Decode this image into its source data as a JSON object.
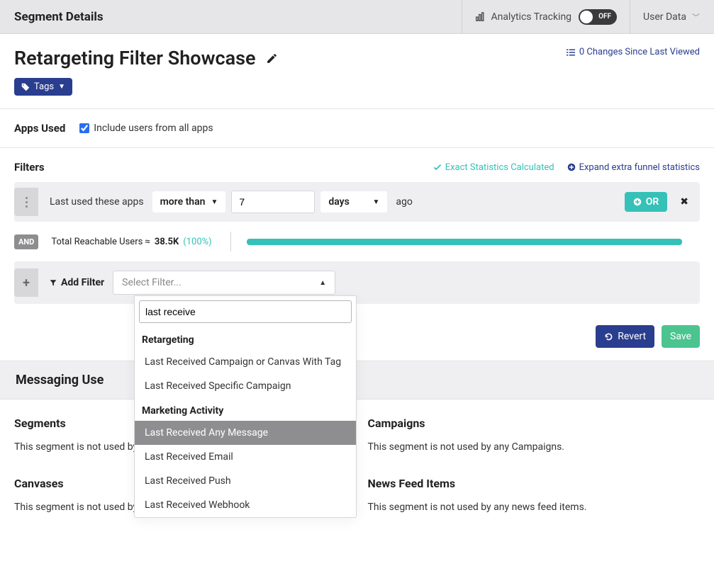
{
  "topbar": {
    "title": "Segment Details",
    "analytics_label": "Analytics Tracking",
    "analytics_state": "OFF",
    "user_data_label": "User Data"
  },
  "title": {
    "heading": "Retargeting Filter Showcase",
    "changes_text": "0 Changes Since Last Viewed",
    "tags_label": "Tags"
  },
  "apps": {
    "section_label": "Apps Used",
    "include_label": "Include users from all apps",
    "include_checked": true
  },
  "filters": {
    "header_label": "Filters",
    "exact_text": "Exact Statistics Calculated",
    "expand_text": "Expand extra funnel statistics",
    "row1": {
      "label": "Last used these apps",
      "comparator": "more than",
      "value": "7",
      "unit": "days",
      "suffix": "ago",
      "or_label": "OR"
    },
    "and_chip": "AND",
    "reachable_prefix": "Total Reachable Users ≈",
    "reachable_count": "38.5K",
    "reachable_pct": "(100%)",
    "add_filter_label": "Add Filter",
    "select_filter_placeholder": "Select Filter...",
    "dropdown": {
      "search_value": "last receive",
      "group1": "Retargeting",
      "opt1": "Last Received Campaign or Canvas With Tag",
      "opt2": "Last Received Specific Campaign",
      "group2": "Marketing Activity",
      "opt3": "Last Received Any Message",
      "opt4": "Last Received Email",
      "opt5": "Last Received Push",
      "opt6": "Last Received Webhook"
    }
  },
  "actions": {
    "revert": "Revert",
    "save": "Save"
  },
  "messaging": {
    "banner": "Messaging Use",
    "segments_h": "Segments",
    "segments_p": "This segment is not used by any Segments.",
    "canvases_h": "Canvases",
    "canvases_p": "This segment is not used by any Canvases.",
    "campaigns_h": "Campaigns",
    "campaigns_p": "This segment is not used by any Campaigns.",
    "news_h": "News Feed Items",
    "news_p": "This segment is not used by any news feed items."
  },
  "colors": {
    "teal": "#35c1b8",
    "navy": "#2a3e8f",
    "green": "#4bc48f"
  }
}
